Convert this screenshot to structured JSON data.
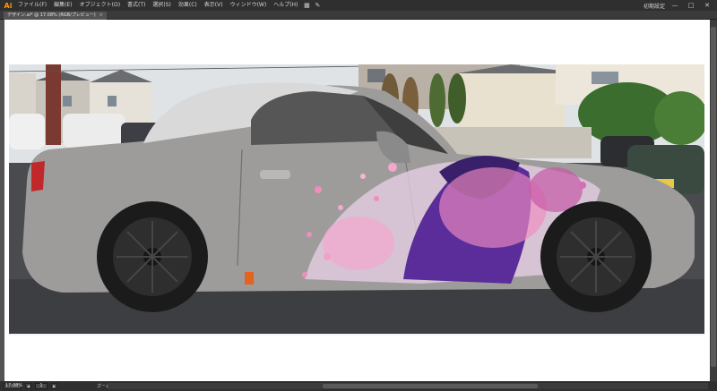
{
  "app": {
    "logo": "Ai",
    "menu": [
      "ファイル(F)",
      "編集(E)",
      "オブジェクト(O)",
      "書式(T)",
      "選択(S)",
      "効果(C)",
      "表示(V)",
      "ウィンドウ(W)",
      "ヘルプ(H)"
    ],
    "workspace": "初期設定",
    "window_buttons": [
      "—",
      "□",
      "✕"
    ]
  },
  "tab": {
    "title": "デザイン.ai* @ 17.08% (RGB/プレビュー)",
    "close": "×"
  },
  "status": {
    "zoom": "17.08%",
    "page": "1",
    "label": "ズーム"
  },
  "colors": {
    "accent": "#ff9a00",
    "ui_dark": "#323232",
    "car_silver": "#9a9a9a",
    "petal_pink": "#f08cc0",
    "hair_purple": "#5a2d9a"
  }
}
